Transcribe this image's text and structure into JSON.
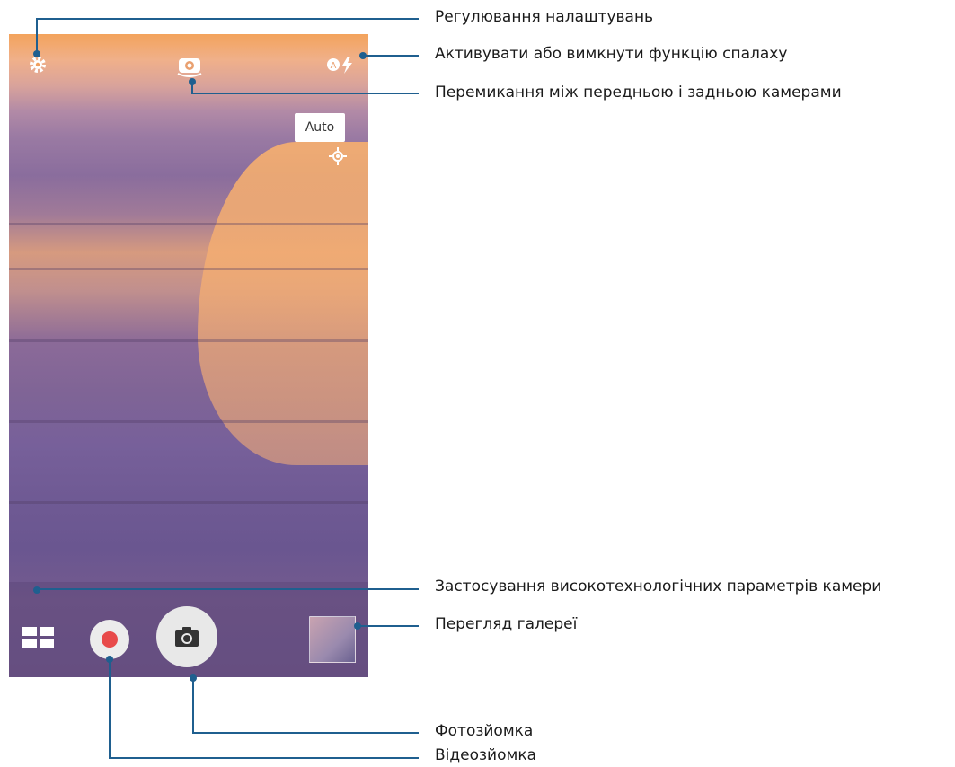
{
  "camera": {
    "focus_mode": "Auto"
  },
  "callouts": {
    "settings": "Регулювання налаштувань",
    "flash": "Активувати або вимкнути функцію спалаху",
    "switch_camera": "Перемикання між передньою і задньою камерами",
    "advanced_modes": "Застосування високотехнологічних параметрів камери",
    "gallery": "Перегляд галереї",
    "photo": "Фотозйомка",
    "video": "Відеозйомка"
  },
  "icons": {
    "settings": "gear-icon",
    "switch": "camera-switch-icon",
    "flash": "flash-auto-icon",
    "focus": "focus-target-icon",
    "modes": "grid-modes-icon",
    "photo": "camera-icon",
    "video": "record-icon"
  },
  "colors": {
    "callout_line": "#1f5f8f",
    "record": "#e84a4a"
  }
}
